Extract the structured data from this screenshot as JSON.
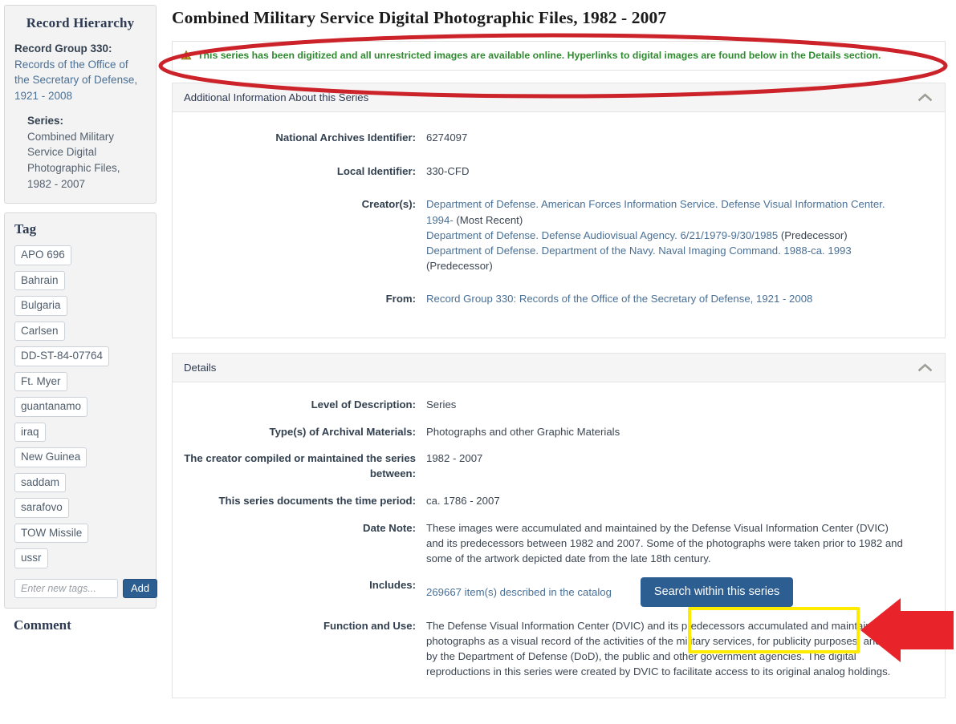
{
  "sidebar": {
    "hierarchy": {
      "title": "Record Hierarchy",
      "record_group_label": "Record Group 330:",
      "record_group_link": "Records of the Office of the Secretary of Defense, 1921 - 2008",
      "series_label": "Series:",
      "series_text": "Combined Military Service Digital Photographic Files, 1982 - 2007"
    },
    "tag": {
      "title": "Tag",
      "items": [
        "APO 696",
        "Bahrain",
        "Bulgaria",
        "Carlsen",
        "DD-ST-84-07764",
        "Ft. Myer",
        "guantanamo",
        "iraq",
        "New Guinea",
        "saddam",
        "sarafovo",
        "TOW Missile",
        "ussr"
      ],
      "input_placeholder": "Enter new tags...",
      "input_value": "",
      "add_label": "Add"
    },
    "comment": {
      "title": "Comment"
    }
  },
  "main": {
    "page_title": "Combined Military Service Digital Photographic Files, 1982 - 2007",
    "alert": {
      "icon": "warning-triangle-icon",
      "text": "This series has been digitized and all unrestricted images are available online. Hyperlinks to digital images are found below in the Details section.",
      "color": "#2f8b2f"
    },
    "additional_info": {
      "header": "Additional Information About this Series",
      "chevron": "chevron-up-icon",
      "rows": [
        {
          "label": "National Archives Identifier:",
          "value": "6274097"
        },
        {
          "label": "Local Identifier:",
          "value": "330-CFD"
        }
      ],
      "creators_label": "Creator(s):",
      "creators": [
        {
          "link": "Department of Defense. American Forces Information Service. Defense Visual Information Center. 1994-",
          "suffix": " (Most Recent)"
        },
        {
          "link": "Department of Defense. Defense Audiovisual Agency. 6/21/1979-9/30/1985",
          "suffix": " (Predecessor)"
        },
        {
          "link": "Department of Defense. Department of the Navy. Naval Imaging Command. 1988-ca. 1993",
          "suffix": " (Predecessor)"
        }
      ],
      "from_label": "From:",
      "from_value": "Record Group 330: Records of the Office of the Secretary of Defense, 1921 - 2008"
    },
    "details": {
      "header": "Details",
      "chevron": "chevron-up-icon",
      "rows": [
        {
          "label": "Level of Description:",
          "value": "Series"
        },
        {
          "label": "Type(s) of Archival Materials:",
          "value": "Photographs and other Graphic Materials"
        },
        {
          "label": "The creator compiled or maintained the series between:",
          "value": "1982 - 2007"
        },
        {
          "label": "This series documents the time period:",
          "value": "ca. 1786 - 2007"
        }
      ],
      "date_note_label": "Date Note:",
      "date_note_value": "These images were accumulated and maintained by the Defense Visual Information Center (DVIC) and its predecessors between 1982 and 2007. Some of the photographs were taken prior to 1982 and some of the artwork depicted date from the late 18th century.",
      "includes_label": "Includes:",
      "includes_value": "269667 item(s) described in the catalog",
      "search_button_label": "Search within this series",
      "function_label": "Function and Use:",
      "function_value": "The Defense Visual Information Center (DVIC) and its predecessors accumulated and maintained these photographs as a visual record of the activities of the military services, for publicity purposes, and for use by the Department of Defense (DoD), the public and other government agencies. The digital reproductions in this series were created by DVIC to facilitate access to its original analog holdings."
    }
  },
  "annotations": {
    "ellipse_color": "#cc2229",
    "highlight_box_color": "#ffeb00",
    "arrow_color": "#e8242a"
  }
}
